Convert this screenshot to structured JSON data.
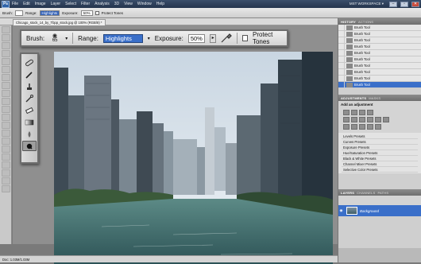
{
  "menubar": {
    "logo": "Ps",
    "items": [
      "File",
      "Edit",
      "Image",
      "Layer",
      "Select",
      "Filter",
      "Analysis",
      "3D",
      "View",
      "Window",
      "Help"
    ],
    "workspace": "MST WORKSPACE ▾",
    "window_buttons": [
      "–",
      "▫",
      "✕"
    ]
  },
  "optbar": {
    "brush_label": "Brush:",
    "range_label": "Range:",
    "range_value": "Highlights",
    "exposure_label": "Exposure:",
    "exposure_value": "50%",
    "protect_label": "Protect Tones"
  },
  "document": {
    "tab_title": "Chicago_stock_14_by_Tbpp_stock.jpg @ 100% (RGB/8) *",
    "status": "Doc: 1.03M/1.03M"
  },
  "zoom_options": {
    "brush_label": "Brush:",
    "brush_size": "65",
    "range_label": "Range:",
    "range_value": "Highlights",
    "exposure_label": "Exposure:",
    "exposure_value": "50%",
    "protect_label": "Protect Tones"
  },
  "panels": {
    "history": {
      "tabs": [
        "HISTORY",
        "ACTIONS"
      ],
      "items": [
        "Brush Tool",
        "Brush Tool",
        "Brush Tool",
        "Brush Tool",
        "Brush Tool",
        "Brush Tool",
        "Brush Tool",
        "Brush Tool",
        "Brush Tool",
        "Brush Tool"
      ],
      "selected_index": 9
    },
    "adjustments": {
      "tabs": [
        "ADJUSTMENTS",
        "MASKS"
      ],
      "title": "Add an adjustment",
      "presets": [
        "Levels Presets",
        "Curves Presets",
        "Exposure Presets",
        "Hue/Saturation Presets",
        "Black & White Presets",
        "Channel Mixer Presets",
        "Selective Color Presets"
      ]
    },
    "layers": {
      "tabs": [
        "LAYERS",
        "CHANNELS",
        "PATHS"
      ],
      "layer_name": "Background"
    }
  },
  "colors": {
    "accent": "#3a6fc9",
    "menubar": "#2c3e5a",
    "panel": "#b9b9b9"
  }
}
